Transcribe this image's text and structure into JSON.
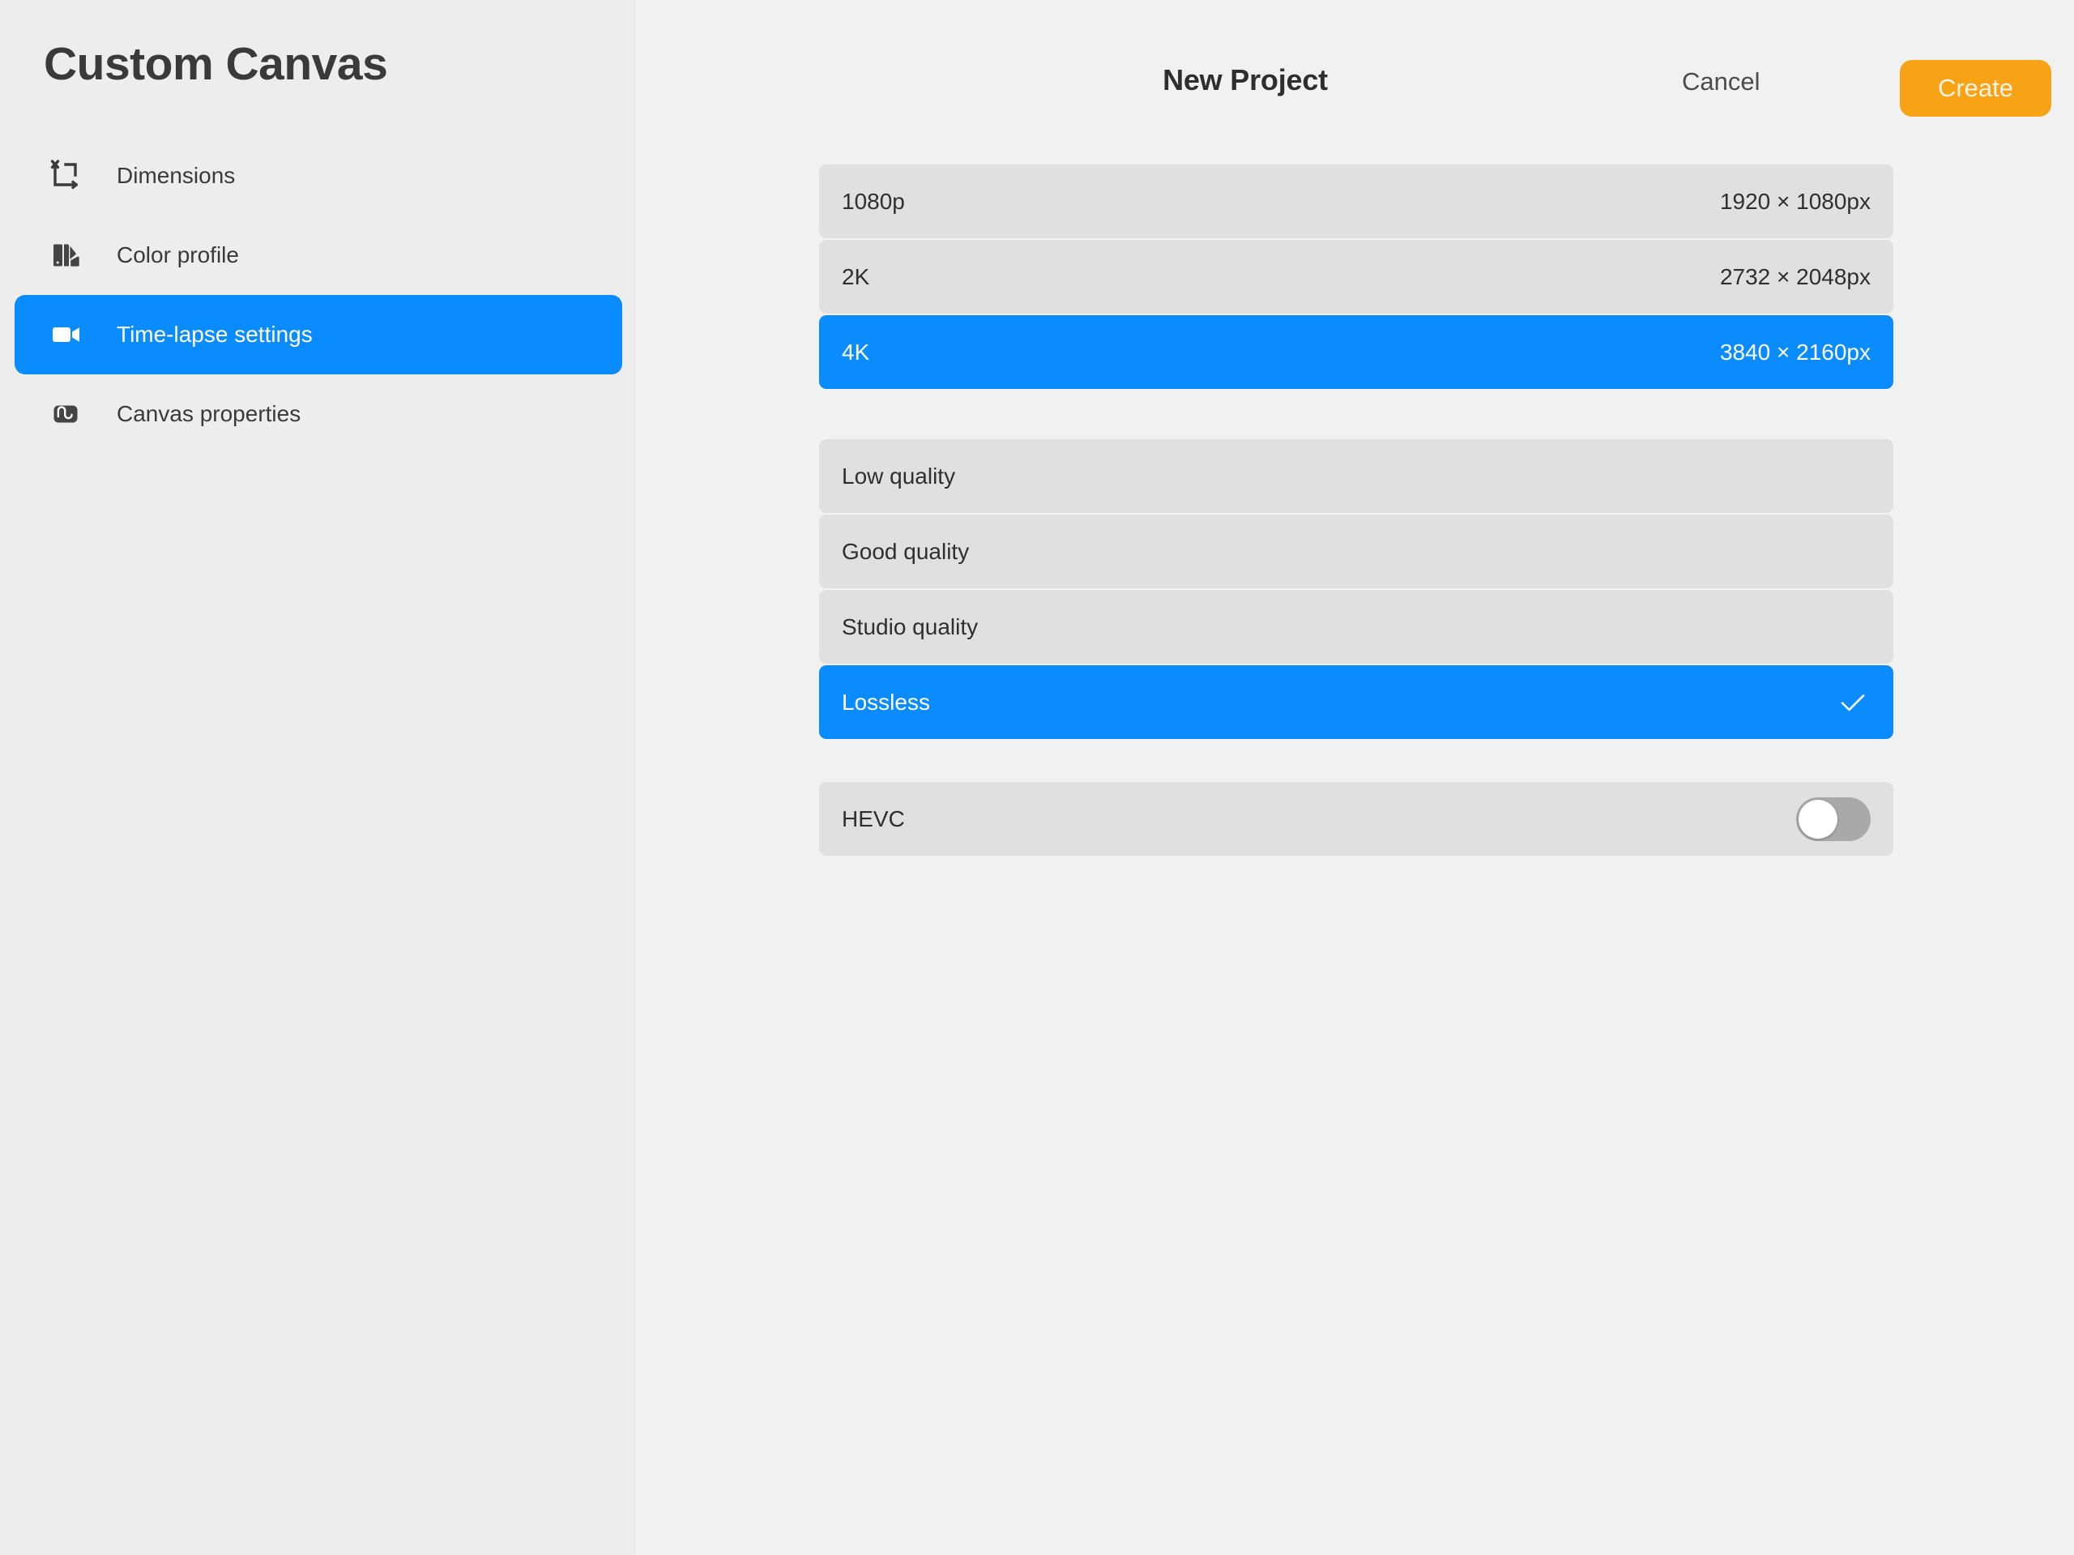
{
  "sidebar": {
    "title": "Custom Canvas",
    "items": [
      {
        "label": "Dimensions",
        "icon": "crop-resize-icon",
        "selected": false
      },
      {
        "label": "Color profile",
        "icon": "color-swatch-icon",
        "selected": false
      },
      {
        "label": "Time-lapse settings",
        "icon": "video-camera-icon",
        "selected": true
      },
      {
        "label": "Canvas properties",
        "icon": "squiggle-icon",
        "selected": false
      }
    ]
  },
  "header": {
    "title": "New Project",
    "cancel_label": "Cancel",
    "create_label": "Create"
  },
  "resolution_group": {
    "rows": [
      {
        "label": "1080p",
        "value": "1920 × 1080px",
        "selected": false
      },
      {
        "label": "2K",
        "value": "2732 × 2048px",
        "selected": false
      },
      {
        "label": "4K",
        "value": "3840 × 2160px",
        "selected": true
      }
    ]
  },
  "quality_group": {
    "rows": [
      {
        "label": "Low quality",
        "selected": false
      },
      {
        "label": "Good quality",
        "selected": false
      },
      {
        "label": "Studio quality",
        "selected": false
      },
      {
        "label": "Lossless",
        "selected": true
      }
    ]
  },
  "codec_group": {
    "rows": [
      {
        "label": "HEVC",
        "toggle_on": false
      }
    ]
  },
  "colors": {
    "accent_blue": "#0a8cff",
    "accent_orange": "#f7a315",
    "sidebar_bg": "#ededed",
    "main_bg": "#f1f1f1",
    "row_bg": "#e0e0e0",
    "title_text": "#3a3a3a",
    "toggle_off_track": "#a9a9a9"
  },
  "icons": {
    "check": "checkmark-icon"
  }
}
